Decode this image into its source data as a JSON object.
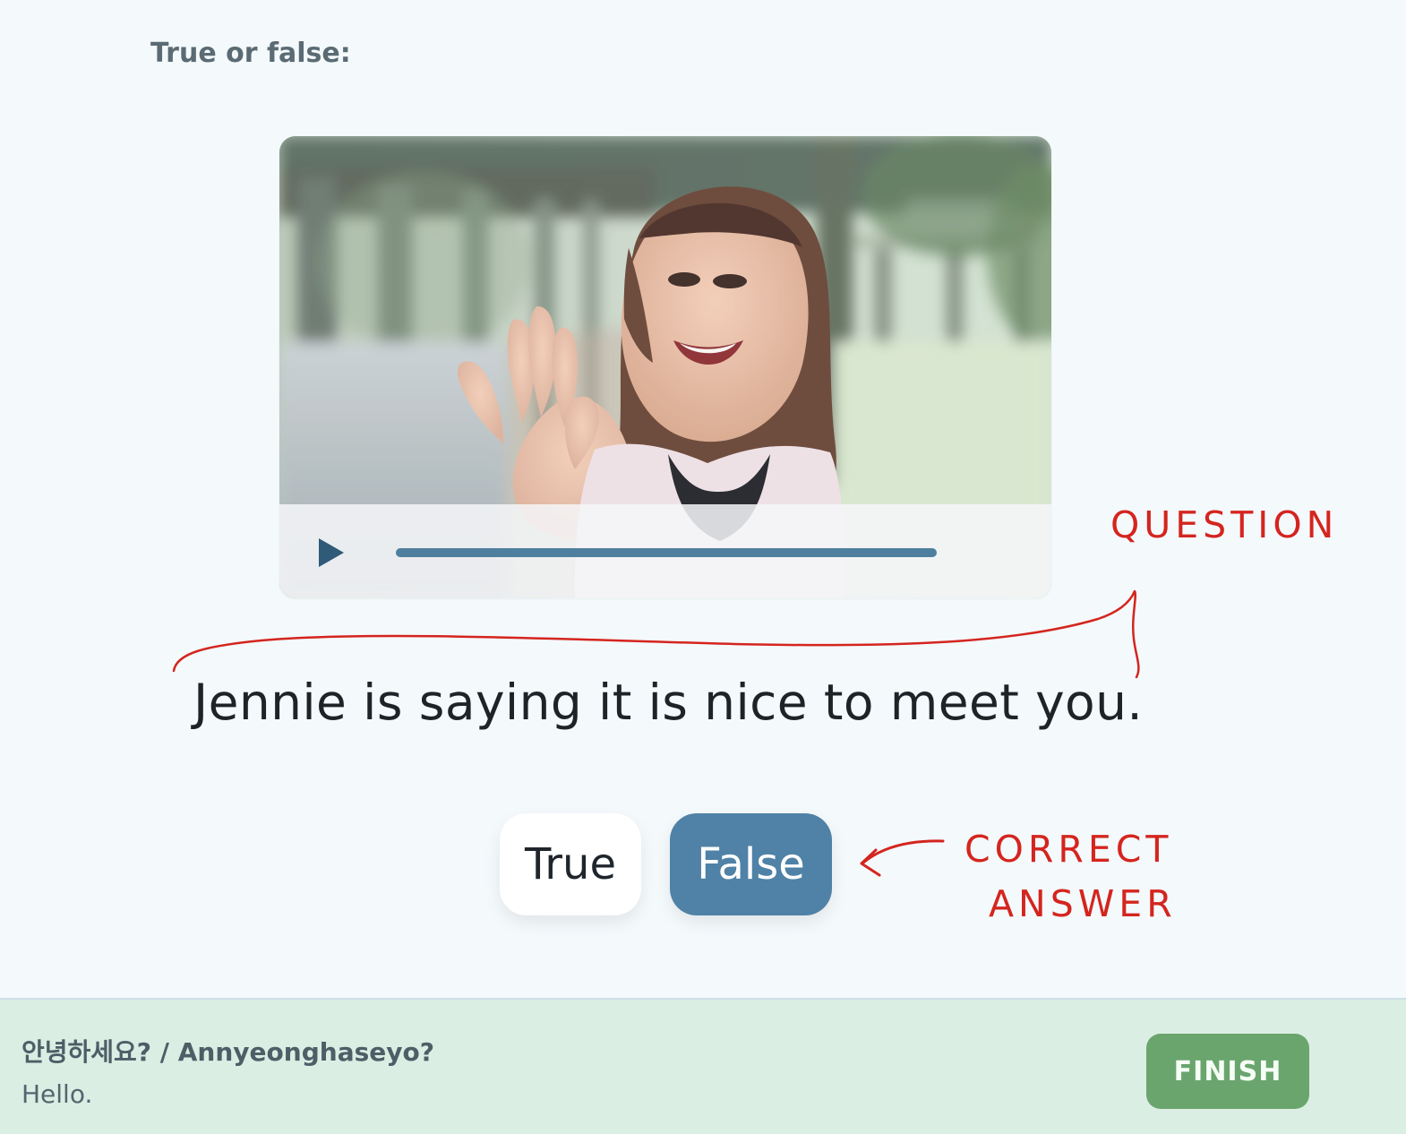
{
  "instructions": {
    "prompt": "True or false:"
  },
  "video": {
    "progress_fraction": 1.0,
    "play_icon": "play-icon",
    "scene_description_icon": "video-thumbnail-image"
  },
  "question": {
    "text": "Jennie is saying it is nice to meet you."
  },
  "answers": {
    "true_label": "True",
    "false_label": "False",
    "selected": "False"
  },
  "annotations": {
    "question_note": "QUESTION",
    "answer_note_line1": "CORRECT",
    "answer_note_line2": "ANSWER",
    "color": "#d4251e"
  },
  "footer": {
    "phrase": "안녕하세요? / Annyeonghaseyo?",
    "translation": "Hello.",
    "finish_label": "FINISH"
  },
  "colors": {
    "background": "#f4f9fc",
    "accent": "#4f82a6",
    "finish": "#6aa56d",
    "footer_bg": "#dbeee3"
  }
}
